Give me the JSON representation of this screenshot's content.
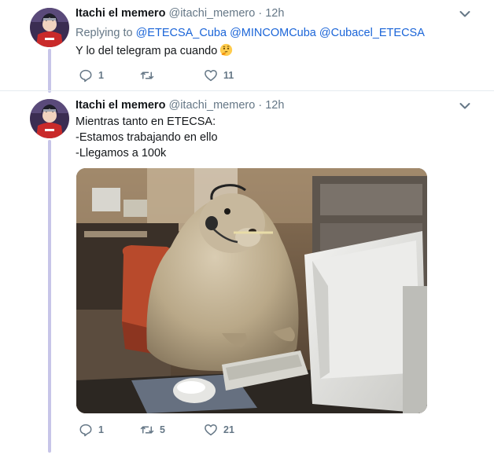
{
  "tweets": [
    {
      "name": "Itachi el memero",
      "handle": "@itachi_memero",
      "separator": "·",
      "time": "12h",
      "replying_prefix": "Replying to",
      "mentions": [
        "@ETECSA_Cuba",
        "@MINCOMCuba",
        "@Cubacel_ETECSA"
      ],
      "lines": [
        "Y lo del telegram pa cuando"
      ],
      "emoji": "thinking-face",
      "reply_count": "1",
      "retweet_count": "",
      "like_count": "11"
    },
    {
      "name": "Itachi el memero",
      "handle": "@itachi_memero",
      "separator": "·",
      "time": "12h",
      "lines": [
        "Mientras tanto en ETECSA:",
        "-Estamos trabajando en ello",
        "-Llegamos a 100k"
      ],
      "media": "groundhog-at-computer-photo",
      "reply_count": "1",
      "retweet_count": "5",
      "like_count": "21"
    }
  ],
  "colors": {
    "thread_line": "#c7c5e8",
    "mention": "#1b65d8",
    "muted": "#657786"
  }
}
